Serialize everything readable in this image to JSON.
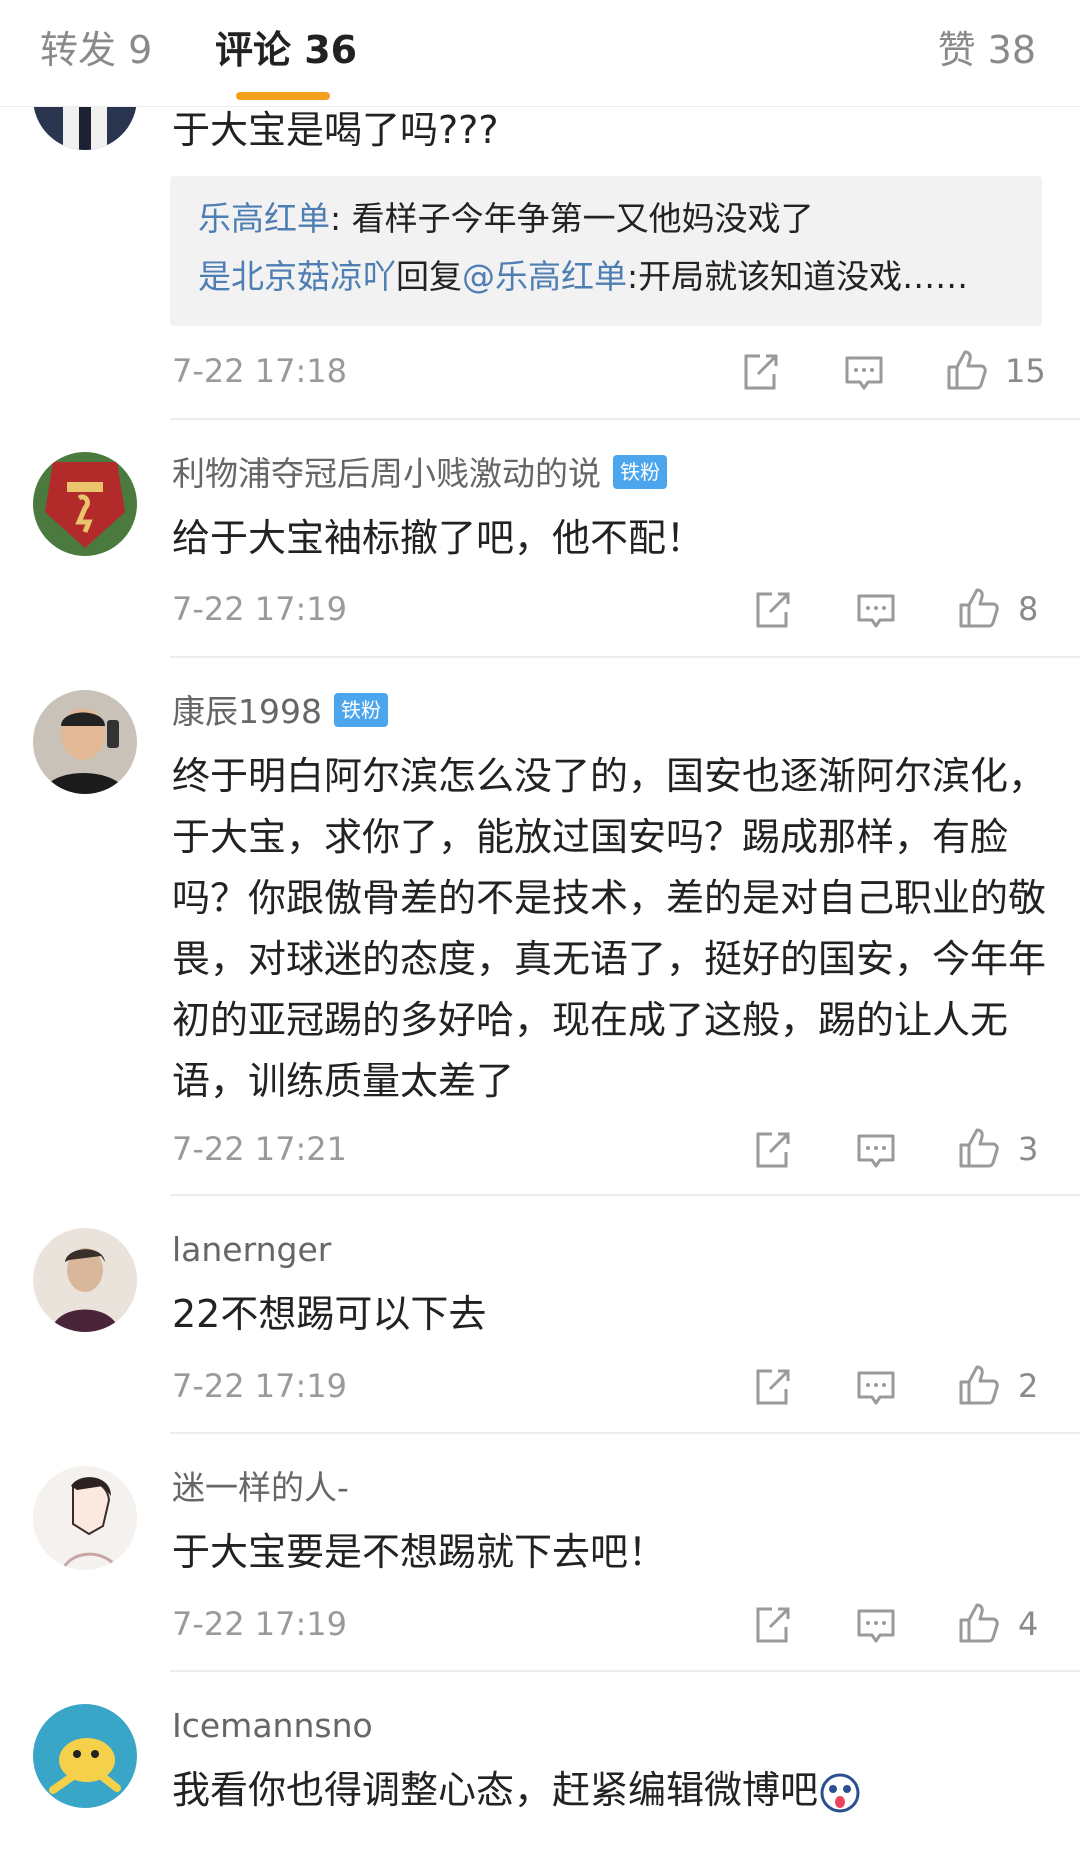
{
  "tabs": {
    "reposts": "转发 9",
    "comments": "评论 36",
    "likes": "赞 38"
  },
  "accent_color": "#f4a01e",
  "link_color": "#4e7eb3",
  "badge_color": "#4ba6ee",
  "comments": [
    {
      "text": "于大宝是喝了吗???",
      "replies": [
        {
          "user": "乐高红单",
          "text": ": 看样子今年争第一又他妈没戏了"
        },
        {
          "user": "是北京菇凉吖",
          "mid": "回复",
          "mention": "@乐高红单",
          "text": ":开局就该知道没戏……"
        }
      ],
      "time": "7-22 17:18",
      "likes": "15"
    },
    {
      "user": "利物浦夺冠后周小贱激动的说",
      "badge": "铁粉",
      "text": "给于大宝袖标撤了吧，他不配！",
      "time": "7-22 17:19",
      "likes": "8"
    },
    {
      "user": "康辰1998",
      "badge": "铁粉",
      "text": "终于明白阿尔滨怎么没了的，国安也逐渐阿尔滨化，于大宝，求你了，能放过国安吗？踢成那样，有脸吗？你跟傲骨差的不是技术，差的是对自己职业的敬畏，对球迷的态度，真无语了，挺好的国安，今年年初的亚冠踢的多好哈，现在成了这般，踢的让人无语，训练质量太差了",
      "time": "7-22 17:21",
      "likes": "3"
    },
    {
      "user": "lanernger",
      "text": "22不想踢可以下去",
      "time": "7-22 17:19",
      "likes": "2"
    },
    {
      "user": "迷一样的人-",
      "text": "于大宝要是不想踢就下去吧！",
      "time": "7-22 17:19",
      "likes": "4"
    },
    {
      "user": "Icemannsno",
      "text": "我看你也得调整心态，赶紧编辑微博吧",
      "emoji": "surprised-emoji"
    }
  ]
}
